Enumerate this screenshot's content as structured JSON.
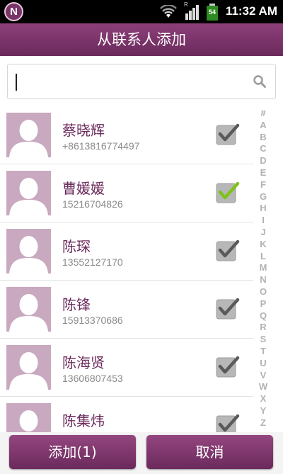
{
  "status_bar": {
    "time": "11:32 AM",
    "battery": "54",
    "app_badge": "N",
    "signal_label": "R"
  },
  "title": "从联系人添加",
  "search": {
    "value": ""
  },
  "contacts": [
    {
      "name": "蔡晓辉",
      "phone": "+8613816774497",
      "checked": false
    },
    {
      "name": "曹媛媛",
      "phone": "15216704826",
      "checked": true
    },
    {
      "name": "陈琛",
      "phone": "13552127170",
      "checked": false
    },
    {
      "name": "陈锋",
      "phone": "15913370686",
      "checked": false
    },
    {
      "name": "陈海贤",
      "phone": "13606807453",
      "checked": false
    },
    {
      "name": "陈集炜",
      "phone": "",
      "checked": false
    }
  ],
  "index_letters": [
    "#",
    "A",
    "B",
    "C",
    "D",
    "E",
    "F",
    "G",
    "H",
    "I",
    "J",
    "K",
    "L",
    "M",
    "N",
    "O",
    "P",
    "Q",
    "R",
    "S",
    "T",
    "U",
    "V",
    "W",
    "X",
    "Y",
    "Z"
  ],
  "buttons": {
    "add": "添加(1)",
    "cancel": "取消"
  },
  "colors": {
    "brand": "#7a3568",
    "check_active": "#7fc21b",
    "check_inactive": "#5a5a5a"
  }
}
